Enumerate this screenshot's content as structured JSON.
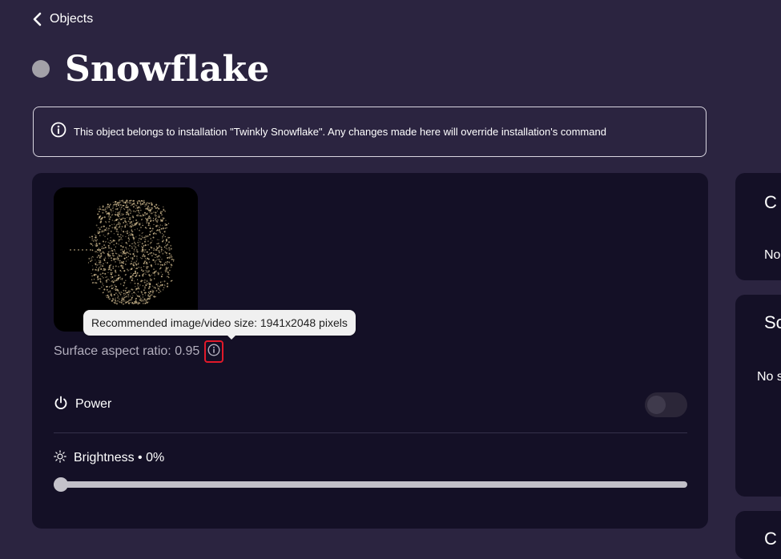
{
  "nav": {
    "back_label": "Objects"
  },
  "page": {
    "title": "Snowflake"
  },
  "notice": {
    "text": "This object belongs to installation \"Twinkly Snowflake\". Any changes made here will override installation's command"
  },
  "surface": {
    "aspect_label": "Surface aspect ratio: 0.95",
    "tooltip": "Recommended image/video size: 1941x2048 pixels"
  },
  "power": {
    "label": "Power",
    "on": false
  },
  "brightness": {
    "label": "Brightness • 0%",
    "value": 0
  },
  "side_cards": [
    {
      "heading": "C",
      "text": "No"
    },
    {
      "heading": "Sc",
      "text": "No s"
    },
    {
      "heading": "C",
      "text": ""
    }
  ],
  "colors": {
    "background": "#2b2440",
    "card": "#141026",
    "tooltip_bg": "#f0f0f0",
    "highlight_border": "#e2192a",
    "snowflake_gold": "#c9b48a"
  },
  "icons": {
    "back": "chevron-left-icon",
    "info": "info-circle-icon",
    "power": "power-icon",
    "brightness": "sun-icon"
  }
}
